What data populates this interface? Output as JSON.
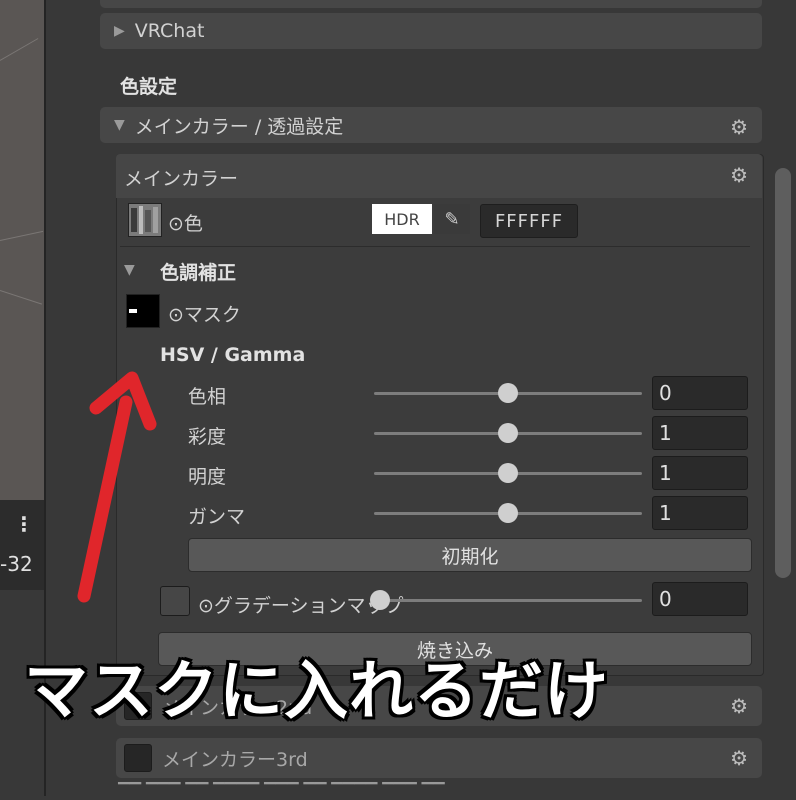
{
  "vrchat_foldout": "VRChat",
  "section_title": "色設定",
  "main_foldout": "メインカラー / 透過設定",
  "panel": {
    "title": "メインカラー",
    "color_label": "⊙色",
    "hdr_label": "HDR",
    "hex_value": "FFFFFF",
    "tone_title": "色調補正",
    "mask_label": "⊙マスク",
    "hsv_title": "HSV / Gamma",
    "sliders": [
      {
        "label": "色相",
        "value": "0",
        "level": 0.5
      },
      {
        "label": "彩度",
        "value": "1",
        "level": 0.5
      },
      {
        "label": "明度",
        "value": "1",
        "level": 0.5
      },
      {
        "label": "ガンマ",
        "value": "1",
        "level": 0.5
      }
    ],
    "reset_button": "初期化",
    "gradient_label": "⊙グラデーションマップ",
    "gradient_value": "0",
    "gradient_level": 0.0,
    "bake_button": "焼き込み"
  },
  "main2": "メインカラー2nd",
  "main3": "メインカラー3rd",
  "left_number": "-32",
  "caption": "マスクに入れるだけ",
  "colors": {
    "arrow": "#e0262b",
    "panel": "#3c3c3c",
    "foldout": "#474747"
  }
}
